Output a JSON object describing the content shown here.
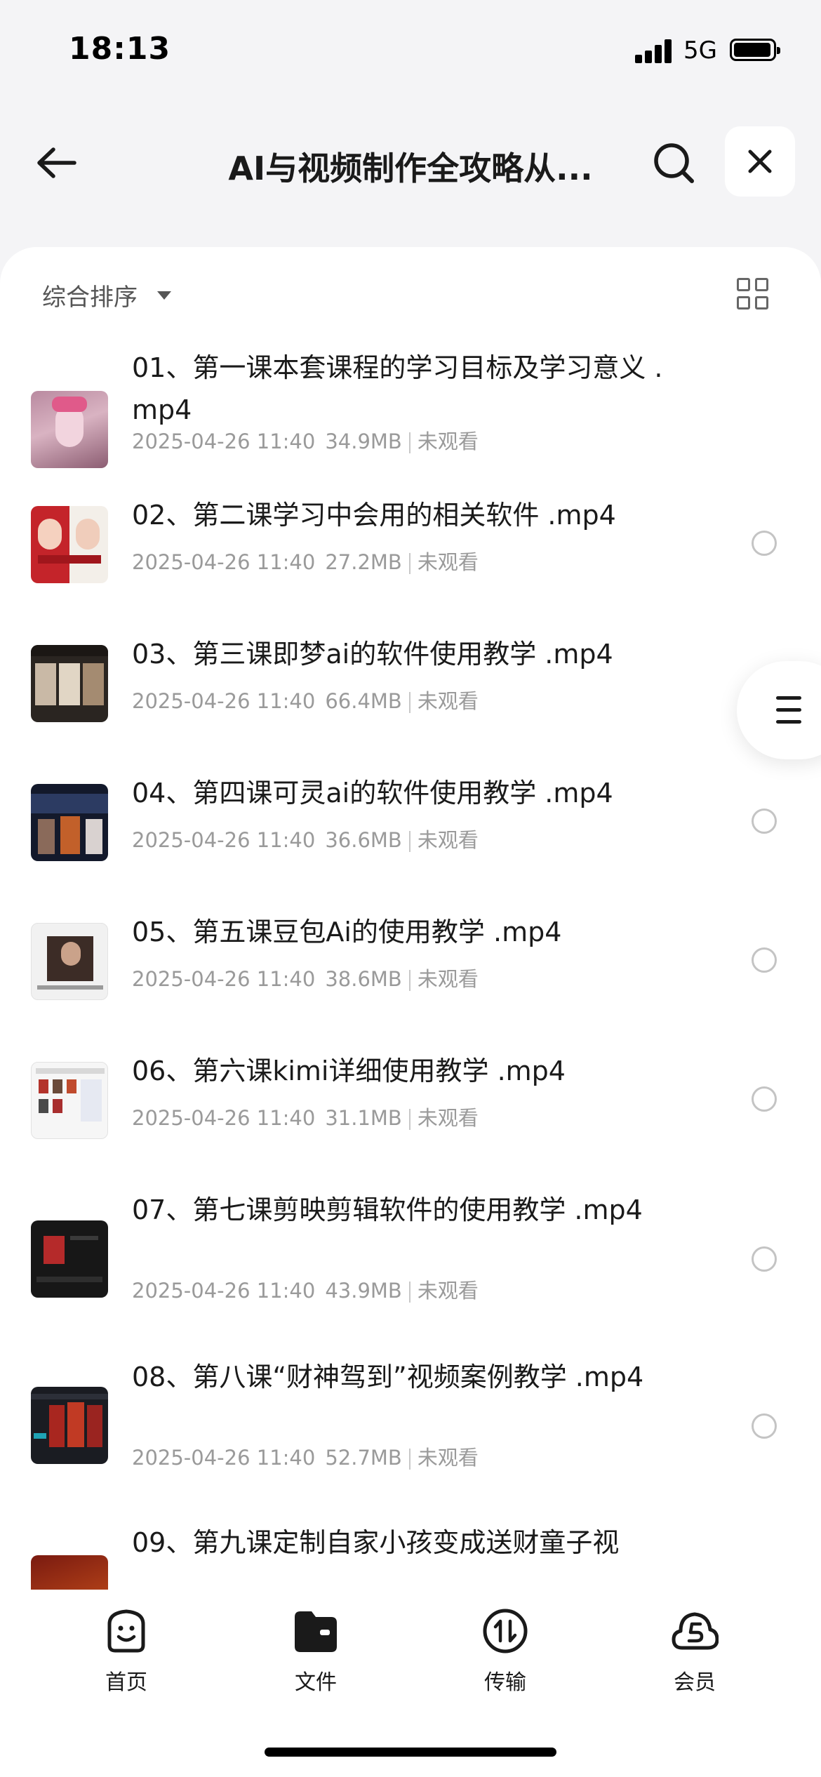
{
  "status_bar": {
    "time": "18:13",
    "network": "5G"
  },
  "header": {
    "title": "AI与视频制作全攻略从..."
  },
  "toolbar": {
    "sort_label": "综合排序"
  },
  "files": [
    {
      "name": "01、第一课本套课程的学习目标及学习意义 .mp4",
      "date": "2025-04-26 11:40",
      "size": "34.9MB",
      "status": "未观看",
      "thumb": "pink-figure"
    },
    {
      "name": "02、第二课学习中会用的相关软件 .mp4",
      "date": "2025-04-26 11:40",
      "size": "27.2MB",
      "status": "未观看",
      "thumb": "red-girls"
    },
    {
      "name": "03、第三课即梦ai的软件使用教学 .mp4",
      "date": "2025-04-26 11:40",
      "size": "66.4MB",
      "status": "未观看",
      "thumb": "dark-portraits"
    },
    {
      "name": "04、第四课可灵ai的软件使用教学 .mp4",
      "date": "2025-04-26 11:40",
      "size": "36.6MB",
      "status": "未观看",
      "thumb": "dark-ui"
    },
    {
      "name": "05、第五课豆包Ai的使用教学 .mp4",
      "date": "2025-04-26 11:40",
      "size": "38.6MB",
      "status": "未观看",
      "thumb": "white-ui-portrait"
    },
    {
      "name": "06、第六课kimi详细使用教学 .mp4",
      "date": "2025-04-26 11:40",
      "size": "31.1MB",
      "status": "未观看",
      "thumb": "white-ui-grid"
    },
    {
      "name": "07、第七课剪映剪辑软件的使用教学 .mp4",
      "date": "2025-04-26 11:40",
      "size": "43.9MB",
      "status": "未观看",
      "thumb": "black-editor"
    },
    {
      "name": "08、第八课“财神驾到”视频案例教学 .mp4",
      "date": "2025-04-26 11:40",
      "size": "52.7MB",
      "status": "未观看",
      "thumb": "dark-red-gods"
    },
    {
      "name": "09、第九课定制自家小孩变成送财童子视",
      "date": "",
      "size": "",
      "status": "",
      "thumb": "red-orange"
    }
  ],
  "tabs": [
    {
      "label": "首页",
      "icon": "smiley-icon"
    },
    {
      "label": "文件",
      "icon": "folder-icon"
    },
    {
      "label": "传输",
      "icon": "transfer-icon"
    },
    {
      "label": "会员",
      "icon": "cloud-member-icon"
    }
  ],
  "colors": {
    "background": "#f4f4f6",
    "card": "#ffffff",
    "text": "#1a1a1a",
    "meta_text": "#9a9a9a"
  }
}
